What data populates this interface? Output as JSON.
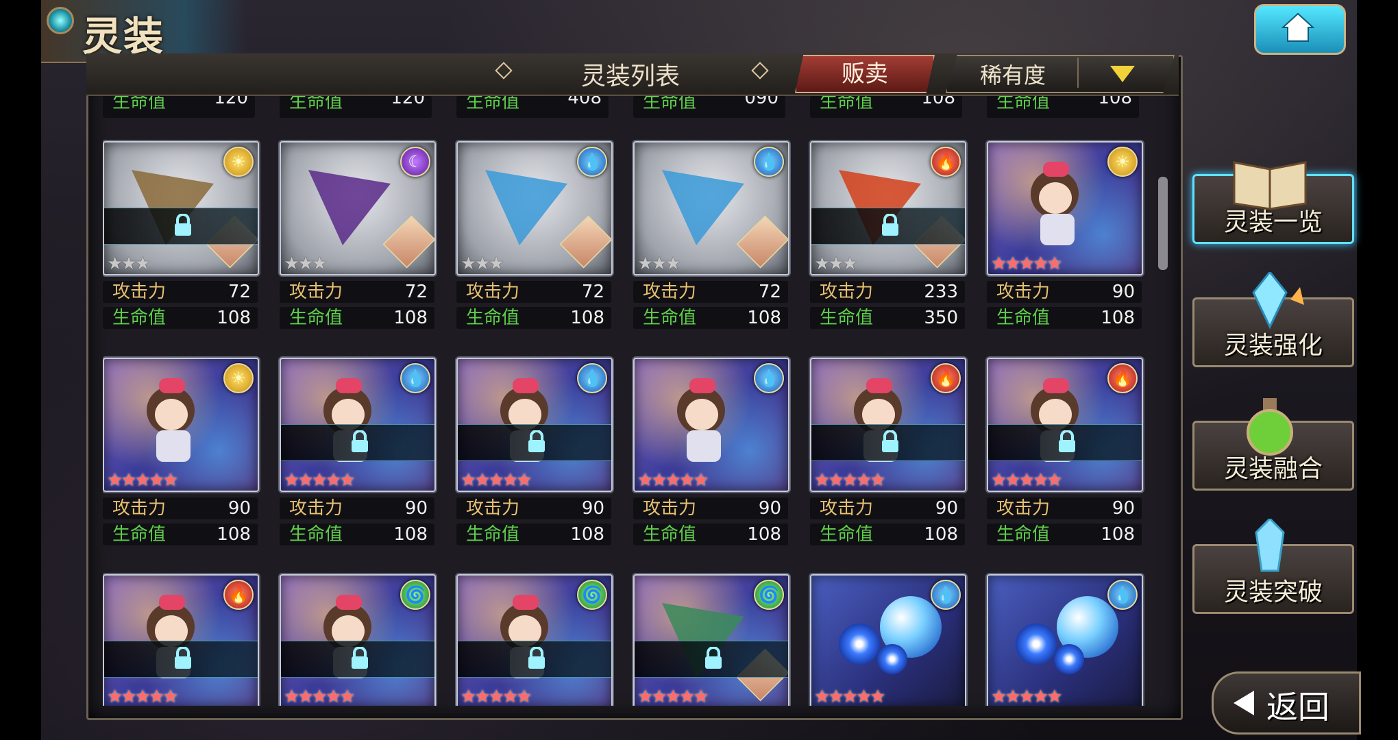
{
  "header": {
    "title": "灵装",
    "list_title": "灵装列表",
    "sell_label": "贩卖",
    "sort_label": "稀有度"
  },
  "partial_row": [
    {
      "hp_label": "生命值",
      "hp": "120"
    },
    {
      "hp_label": "生命值",
      "hp": "120"
    },
    {
      "hp_label": "生命值",
      "hp": "408"
    },
    {
      "hp_label": "生命值",
      "hp": "090"
    },
    {
      "hp_label": "生命值",
      "hp": "108"
    },
    {
      "hp_label": "生命值",
      "hp": "108"
    }
  ],
  "cards": [
    {
      "element": "light",
      "art": "weapon-staff",
      "locked": true,
      "stars": 3,
      "max_stars": 3,
      "atk_label": "攻击力",
      "atk": "72",
      "hp_label": "生命值",
      "hp": "108"
    },
    {
      "element": "dark",
      "art": "weapon-dark",
      "locked": false,
      "stars": 3,
      "max_stars": 3,
      "atk_label": "攻击力",
      "atk": "72",
      "hp_label": "生命值",
      "hp": "108"
    },
    {
      "element": "water",
      "art": "weapon-ice",
      "locked": false,
      "stars": 3,
      "max_stars": 3,
      "atk_label": "攻击力",
      "atk": "72",
      "hp_label": "生命值",
      "hp": "108"
    },
    {
      "element": "water",
      "art": "weapon-ice",
      "locked": false,
      "stars": 3,
      "max_stars": 3,
      "atk_label": "攻击力",
      "atk": "72",
      "hp_label": "生命值",
      "hp": "108"
    },
    {
      "element": "fire",
      "art": "weapon-fire",
      "locked": true,
      "stars": 3,
      "max_stars": 3,
      "atk_label": "攻击力",
      "atk": "233",
      "hp_label": "生命值",
      "hp": "350"
    },
    {
      "element": "light",
      "art": "doll",
      "locked": false,
      "stars": 5,
      "max_stars": 5,
      "atk_label": "攻击力",
      "atk": "90",
      "hp_label": "生命值",
      "hp": "108"
    },
    {
      "element": "light",
      "art": "doll",
      "locked": false,
      "stars": 5,
      "max_stars": 5,
      "atk_label": "攻击力",
      "atk": "90",
      "hp_label": "生命值",
      "hp": "108"
    },
    {
      "element": "water",
      "art": "doll",
      "locked": true,
      "stars": 5,
      "max_stars": 5,
      "atk_label": "攻击力",
      "atk": "90",
      "hp_label": "生命值",
      "hp": "108"
    },
    {
      "element": "water",
      "art": "doll",
      "locked": true,
      "stars": 5,
      "max_stars": 5,
      "atk_label": "攻击力",
      "atk": "90",
      "hp_label": "生命值",
      "hp": "108"
    },
    {
      "element": "water",
      "art": "doll",
      "locked": false,
      "stars": 5,
      "max_stars": 5,
      "atk_label": "攻击力",
      "atk": "90",
      "hp_label": "生命值",
      "hp": "108"
    },
    {
      "element": "fire",
      "art": "doll",
      "locked": true,
      "stars": 5,
      "max_stars": 5,
      "atk_label": "攻击力",
      "atk": "90",
      "hp_label": "生命值",
      "hp": "108"
    },
    {
      "element": "fire",
      "art": "doll",
      "locked": true,
      "stars": 5,
      "max_stars": 5,
      "atk_label": "攻击力",
      "atk": "90",
      "hp_label": "生命值",
      "hp": "108"
    },
    {
      "element": "fire",
      "art": "doll",
      "locked": true,
      "stars": 5,
      "max_stars": 5
    },
    {
      "element": "wind",
      "art": "doll",
      "locked": true,
      "stars": 5,
      "max_stars": 5
    },
    {
      "element": "wind",
      "art": "doll",
      "locked": true,
      "stars": 5,
      "max_stars": 5
    },
    {
      "element": "wind",
      "art": "weapon-green",
      "locked": true,
      "stars": 5,
      "max_stars": 5
    },
    {
      "element": "water",
      "art": "flower-orb",
      "locked": false,
      "stars": 5,
      "max_stars": 5
    },
    {
      "element": "water",
      "art": "flower-orb",
      "locked": false,
      "stars": 5,
      "max_stars": 5
    }
  ],
  "menu": [
    {
      "label": "灵装一览",
      "active": true,
      "icon": "book-icon"
    },
    {
      "label": "灵装强化",
      "active": false,
      "icon": "crystal-icon"
    },
    {
      "label": "灵装融合",
      "active": false,
      "icon": "potion-icon"
    },
    {
      "label": "灵装突破",
      "active": false,
      "icon": "gem-icon"
    }
  ],
  "back_label": "返回",
  "element_glyphs": {
    "light": "☀",
    "dark": "☾",
    "water": "💧",
    "fire": "🔥",
    "wind": "🌀"
  }
}
